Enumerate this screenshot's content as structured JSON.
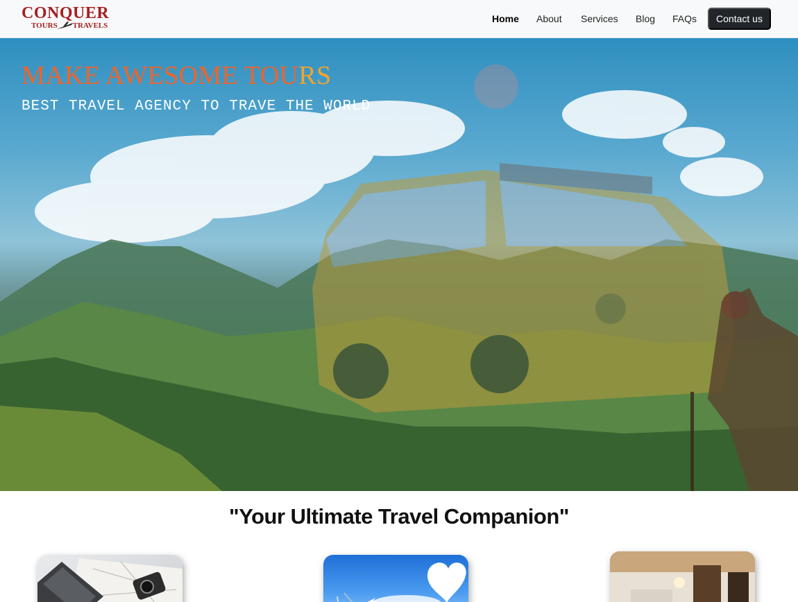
{
  "brand": {
    "name_top": "CONQUER",
    "name_left": "TOURS",
    "name_right": "TRAVELS",
    "color": "#a51f1f"
  },
  "nav": {
    "links": [
      {
        "label": "Home",
        "active": true
      },
      {
        "label": "About",
        "active": false
      },
      {
        "label": "Services",
        "active": false
      },
      {
        "label": "Blog",
        "active": false
      },
      {
        "label": "FAQs",
        "active": false
      }
    ],
    "cta_label": "Contact us"
  },
  "hero": {
    "title_main": "MAKE AWESOME TOU",
    "title_tail": "RS",
    "subtitle": "BEST TRAVEL AGENCY TO TRAVE THE WORLD",
    "title_color": "#f0642a",
    "title_tail_color": "#f3a42b"
  },
  "tagline": "\"Your Ultimate Travel Companion\"",
  "cards": [
    {
      "icon": "laptop-map-camera-photo"
    },
    {
      "icon": "sky-heart-cloud-photo"
    },
    {
      "icon": "interior-room-photo"
    }
  ]
}
